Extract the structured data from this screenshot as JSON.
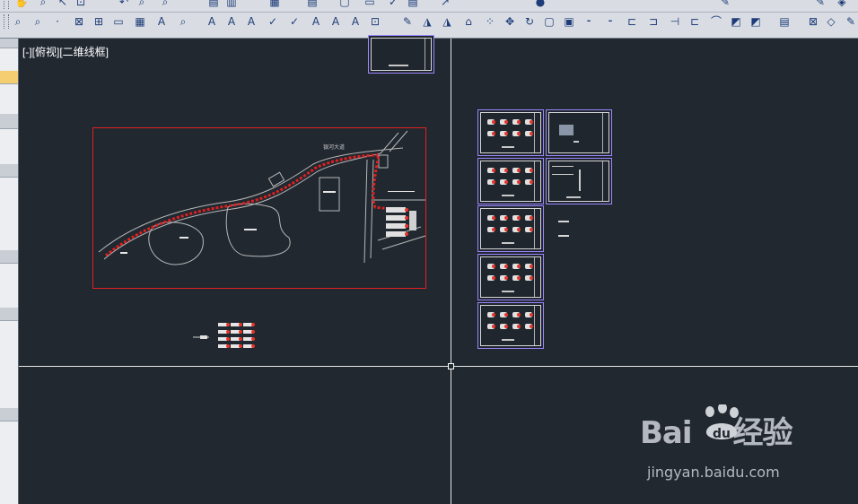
{
  "viewport": {
    "label": "[-][俯视][二维线框]"
  },
  "toolbar": {
    "row1_icons": [
      "zoom-icon",
      "pan-icon",
      "select-icon",
      "zoom-window-icon",
      "zoom-previous-icon",
      "text-icon",
      "spell-icon",
      "layer-icon",
      "layer-state-icon",
      "match-props-icon",
      "copy-icon",
      "insert-icon"
    ],
    "row2_icons": [
      "pan-realtime-icon",
      "zoom-realtime-icon",
      "zoom-extents-icon",
      "properties-icon",
      "block-icon",
      "table-icon",
      "text-style-icon",
      "multiline-text-icon",
      "text-edit-icon",
      "text-find-icon",
      "spell-check-icon",
      "scale-text-icon",
      "justify-text-icon",
      "dimension-icon",
      "linear-dim-icon",
      "aligned-dim-icon",
      "arc-length-icon",
      "ordinate-dim-icon",
      "radius-dim-icon",
      "move-icon",
      "rotate-icon",
      "break-icon",
      "join-icon",
      "chamfer-icon",
      "fillet-icon",
      "explode-icon",
      "draworder-icon",
      "measure-icon"
    ]
  },
  "drawing": {
    "road_label": "银河大道"
  },
  "watermark": {
    "logo_text_1": "Bai",
    "logo_text_2": "经验",
    "paw_text": "du",
    "url": "jingyan.baidu.com"
  },
  "colors": {
    "background": "#212830",
    "toolbar": "#d9dde3",
    "sheet_border": "#9c86ff",
    "plan_frame": "#e02020",
    "marker_red": "#e8332a"
  }
}
